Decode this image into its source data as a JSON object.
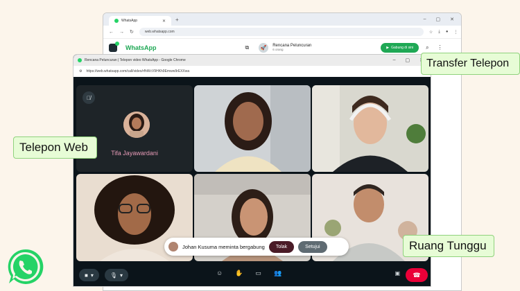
{
  "back_browser": {
    "tab_title": "WhatsApp",
    "address": "web.whatsapp.com",
    "app_name": "WhatsApp",
    "group_name": "Rencana Peluncuran",
    "group_sub": "6 orang",
    "join_button": "Gabung di sini"
  },
  "front_window": {
    "title": "Rencana Peluncuran | Telepon video WhatsApp - Google Chrome",
    "address": "https://web.whatsapp.com/call/video/rfhWcV9HKh9Emww9rEXXwa"
  },
  "call": {
    "host_name": "Tifa Jayawardani",
    "join_request_text": "Johan Kusuma meminta bergabung",
    "reject_label": "Tolak",
    "accept_label": "Setujui"
  },
  "callouts": {
    "transfer": "Transfer Telepon",
    "web": "Telepon Web",
    "waiting": "Ruang Tunggu"
  },
  "colors": {
    "accent_green": "#25d366",
    "callout_bg": "#e7fcd6",
    "end_call_red": "#ea0038",
    "page_bg": "#fcf5eb"
  }
}
